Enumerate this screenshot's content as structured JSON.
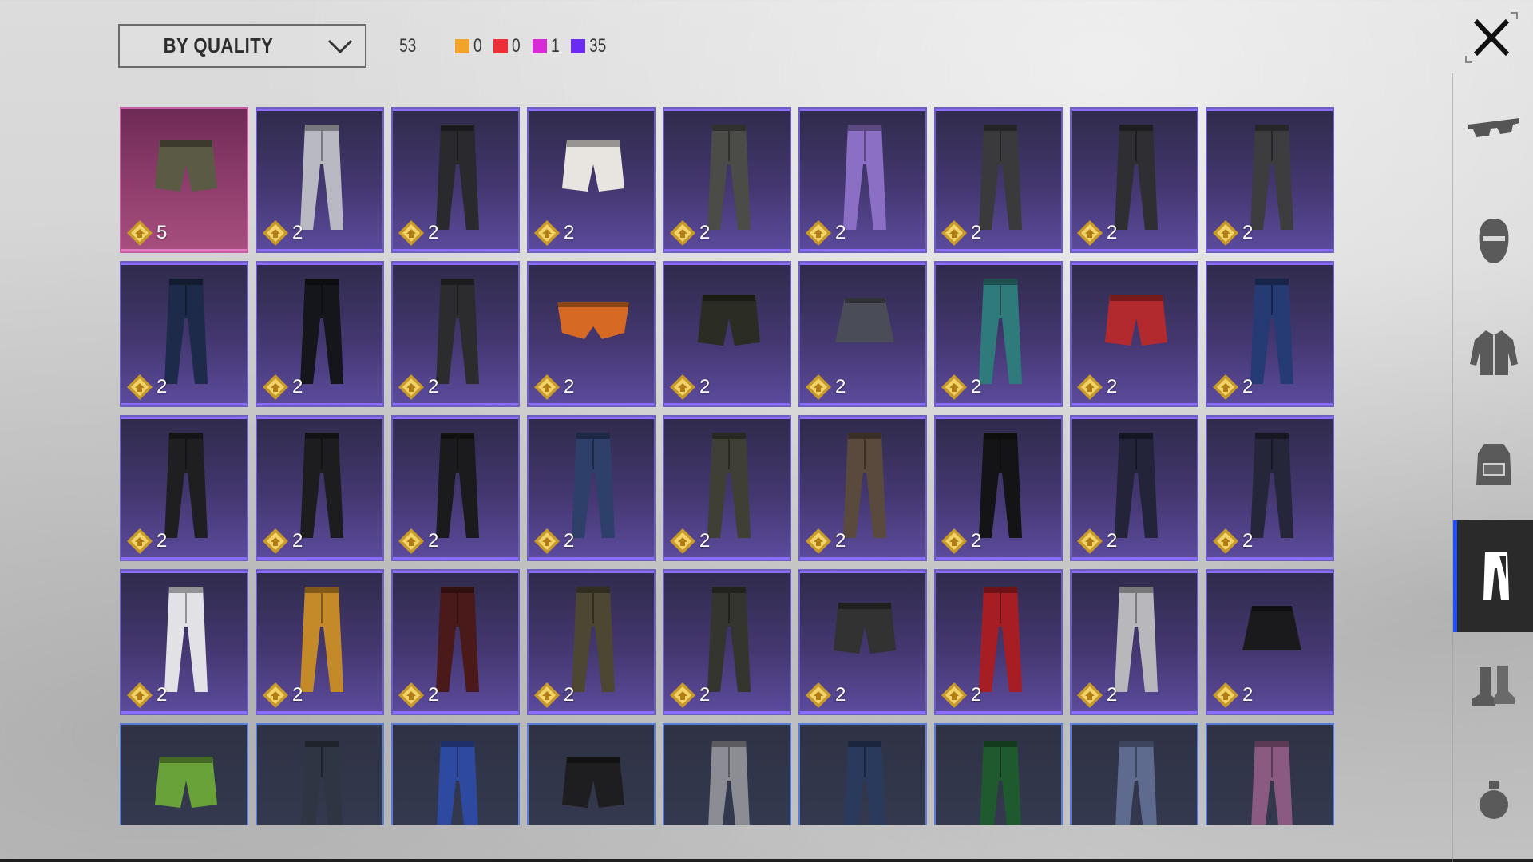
{
  "header": {
    "sort_label": "BY QUALITY",
    "total_count": "53",
    "quality_counts": [
      {
        "color": "#f0a42a",
        "count": "0"
      },
      {
        "color": "#ef2f37",
        "count": "0"
      },
      {
        "color": "#d82ad6",
        "count": "1"
      },
      {
        "color": "#6a2cf2",
        "count": "35"
      }
    ]
  },
  "sidebar": {
    "tabs": [
      {
        "icon": "glasses-icon",
        "active": false
      },
      {
        "icon": "mask-icon",
        "active": false
      },
      {
        "icon": "jacket-icon",
        "active": false
      },
      {
        "icon": "backpack-icon",
        "active": false
      },
      {
        "icon": "pants-icon",
        "active": true
      },
      {
        "icon": "boots-icon",
        "active": false
      },
      {
        "icon": "grenade-icon",
        "active": false
      }
    ]
  },
  "items": [
    {
      "quality": "pink",
      "count": "5",
      "kind": "shorts",
      "color": "#5b5a45"
    },
    {
      "quality": "purple",
      "count": "2",
      "kind": "pants",
      "color": "#b9b9c4"
    },
    {
      "quality": "purple",
      "count": "2",
      "kind": "pants",
      "color": "#2a2a2e"
    },
    {
      "quality": "purple",
      "count": "2",
      "kind": "shorts",
      "color": "#e8e4e0"
    },
    {
      "quality": "purple",
      "count": "2",
      "kind": "pants",
      "color": "#4b4b48"
    },
    {
      "quality": "purple",
      "count": "2",
      "kind": "pants",
      "color": "#8a6fc4"
    },
    {
      "quality": "purple",
      "count": "2",
      "kind": "pants",
      "color": "#3a3a3c"
    },
    {
      "quality": "purple",
      "count": "2",
      "kind": "pants",
      "color": "#2f2f33"
    },
    {
      "quality": "purple",
      "count": "2",
      "kind": "pants",
      "color": "#3d3d3f"
    },
    {
      "quality": "purple",
      "count": "2",
      "kind": "pants",
      "color": "#1e2a4a"
    },
    {
      "quality": "purple",
      "count": "2",
      "kind": "pants",
      "color": "#15161c"
    },
    {
      "quality": "purple",
      "count": "2",
      "kind": "pants",
      "color": "#2c2c2e"
    },
    {
      "quality": "purple",
      "count": "2",
      "kind": "briefs",
      "color": "#d66a24"
    },
    {
      "quality": "purple",
      "count": "2",
      "kind": "shorts",
      "color": "#2b2c24"
    },
    {
      "quality": "purple",
      "count": "2",
      "kind": "skirt",
      "color": "#4a4d57"
    },
    {
      "quality": "purple",
      "count": "2",
      "kind": "pants",
      "color": "#2f7a7a"
    },
    {
      "quality": "purple",
      "count": "2",
      "kind": "shorts",
      "color": "#b22a2e"
    },
    {
      "quality": "purple",
      "count": "2",
      "kind": "pants",
      "color": "#263a74"
    },
    {
      "quality": "purple",
      "count": "2",
      "kind": "pants",
      "color": "#1f1f22"
    },
    {
      "quality": "purple",
      "count": "2",
      "kind": "pants",
      "color": "#1d1d20"
    },
    {
      "quality": "purple",
      "count": "2",
      "kind": "pants",
      "color": "#1b1b1d"
    },
    {
      "quality": "purple",
      "count": "2",
      "kind": "pants",
      "color": "#2e3f6a"
    },
    {
      "quality": "purple",
      "count": "2",
      "kind": "pants",
      "color": "#3f3f36"
    },
    {
      "quality": "purple",
      "count": "2",
      "kind": "pants",
      "color": "#5a4a3d"
    },
    {
      "quality": "purple",
      "count": "2",
      "kind": "pants",
      "color": "#141416"
    },
    {
      "quality": "purple",
      "count": "2",
      "kind": "pants",
      "color": "#23243a"
    },
    {
      "quality": "purple",
      "count": "2",
      "kind": "pants",
      "color": "#26263a"
    },
    {
      "quality": "purple",
      "count": "2",
      "kind": "pants",
      "color": "#e2e2e6"
    },
    {
      "quality": "purple",
      "count": "2",
      "kind": "pants",
      "color": "#c48a2a"
    },
    {
      "quality": "purple",
      "count": "2",
      "kind": "pants",
      "color": "#4a1a1a"
    },
    {
      "quality": "purple",
      "count": "2",
      "kind": "pants",
      "color": "#4c4632"
    },
    {
      "quality": "purple",
      "count": "2",
      "kind": "pants",
      "color": "#35352f"
    },
    {
      "quality": "purple",
      "count": "2",
      "kind": "shorts",
      "color": "#323232"
    },
    {
      "quality": "purple",
      "count": "2",
      "kind": "pants",
      "color": "#a61e24"
    },
    {
      "quality": "purple",
      "count": "2",
      "kind": "pants",
      "color": "#b8b8bc"
    },
    {
      "quality": "purple",
      "count": "2",
      "kind": "skirt",
      "color": "#1a1a1c"
    },
    {
      "quality": "blue",
      "count": "",
      "kind": "shorts",
      "color": "#6aa23a"
    },
    {
      "quality": "blue",
      "count": "",
      "kind": "pants",
      "color": "#2e3644"
    },
    {
      "quality": "blue",
      "count": "",
      "kind": "pants",
      "color": "#2d4aa0"
    },
    {
      "quality": "blue",
      "count": "",
      "kind": "shorts",
      "color": "#1e1e20"
    },
    {
      "quality": "blue",
      "count": "",
      "kind": "pants",
      "color": "#8c8c94"
    },
    {
      "quality": "blue",
      "count": "",
      "kind": "pants",
      "color": "#2a3a5c"
    },
    {
      "quality": "blue",
      "count": "",
      "kind": "pants",
      "color": "#1f5a2e"
    },
    {
      "quality": "blue",
      "count": "",
      "kind": "pants",
      "color": "#5e6a8e"
    },
    {
      "quality": "blue",
      "count": "",
      "kind": "pants",
      "color": "#8a5a82"
    }
  ]
}
